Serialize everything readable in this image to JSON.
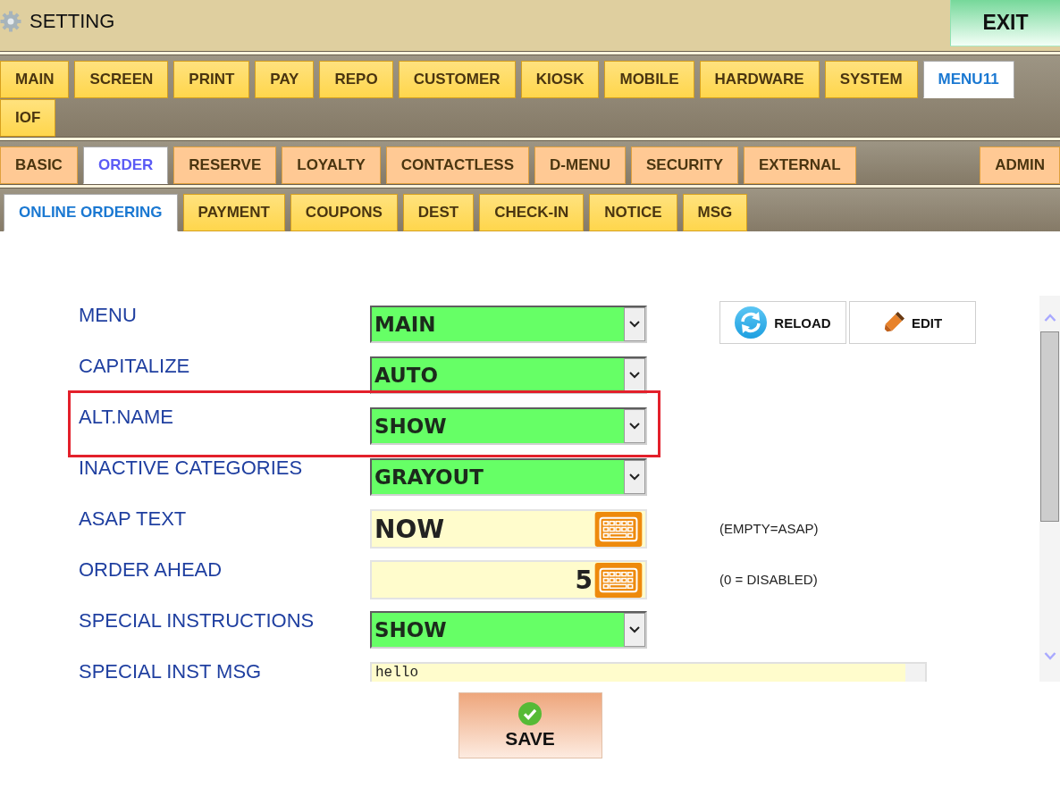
{
  "header": {
    "title": "SETTING",
    "exit_button": "EXIT"
  },
  "main_tabs": [
    {
      "label": "MAIN",
      "selected": false
    },
    {
      "label": "SCREEN",
      "selected": false
    },
    {
      "label": "PRINT",
      "selected": false
    },
    {
      "label": "PAY",
      "selected": false
    },
    {
      "label": "REPO",
      "selected": false
    },
    {
      "label": "CUSTOMER",
      "selected": false
    },
    {
      "label": "KIOSK",
      "selected": false
    },
    {
      "label": "MOBILE",
      "selected": false
    },
    {
      "label": "HARDWARE",
      "selected": false
    },
    {
      "label": "SYSTEM",
      "selected": false
    },
    {
      "label": "MENU11",
      "selected": true
    },
    {
      "label": "IOF",
      "selected": false
    }
  ],
  "section_tabs": {
    "tabs": [
      {
        "label": "BASIC",
        "selected": false
      },
      {
        "label": "ORDER",
        "selected": true
      },
      {
        "label": "RESERVE",
        "selected": false
      },
      {
        "label": "LOYALTY",
        "selected": false
      },
      {
        "label": "CONTACTLESS",
        "selected": false
      },
      {
        "label": "D-MENU",
        "selected": false
      },
      {
        "label": "SECURITY",
        "selected": false
      },
      {
        "label": "EXTERNAL",
        "selected": false
      }
    ],
    "end_tabs": [
      {
        "label": "ADMIN",
        "selected": false
      }
    ]
  },
  "page_tabs": [
    {
      "label": "ONLINE ORDERING",
      "selected": true
    },
    {
      "label": "PAYMENT",
      "selected": false
    },
    {
      "label": "COUPONS",
      "selected": false
    },
    {
      "label": "DEST",
      "selected": false
    },
    {
      "label": "CHECK-IN",
      "selected": false
    },
    {
      "label": "NOTICE",
      "selected": false
    },
    {
      "label": "MSG",
      "selected": false
    }
  ],
  "form": {
    "actions": [
      {
        "label": "RELOAD",
        "kind": "reload"
      },
      {
        "label": "EDIT",
        "kind": "edit"
      }
    ],
    "rows": [
      {
        "label": "MENU",
        "kind": "select",
        "value": "MAIN",
        "highlighted": false
      },
      {
        "label": "CAPITALIZE",
        "kind": "select",
        "value": "AUTO",
        "highlighted": false
      },
      {
        "label": "ALT.NAME",
        "kind": "select",
        "value": "SHOW",
        "highlighted": true
      },
      {
        "label": "INACTIVE CATEGORIES",
        "kind": "select",
        "value": "GRAYOUT",
        "highlighted": false
      },
      {
        "label": "ASAP TEXT",
        "kind": "text",
        "value": "NOW",
        "hint": "(EMPTY=ASAP)",
        "highlighted": false
      },
      {
        "label": "ORDER AHEAD",
        "kind": "number",
        "value": "5",
        "hint": "(0 = DISABLED)",
        "highlighted": false
      },
      {
        "label": "SPECIAL INSTRUCTIONS",
        "kind": "select",
        "value": "SHOW",
        "highlighted": false
      },
      {
        "label": "SPECIAL INST MSG",
        "kind": "textarea",
        "value": "hello",
        "highlighted": false
      }
    ]
  },
  "save_button": "SAVE"
}
